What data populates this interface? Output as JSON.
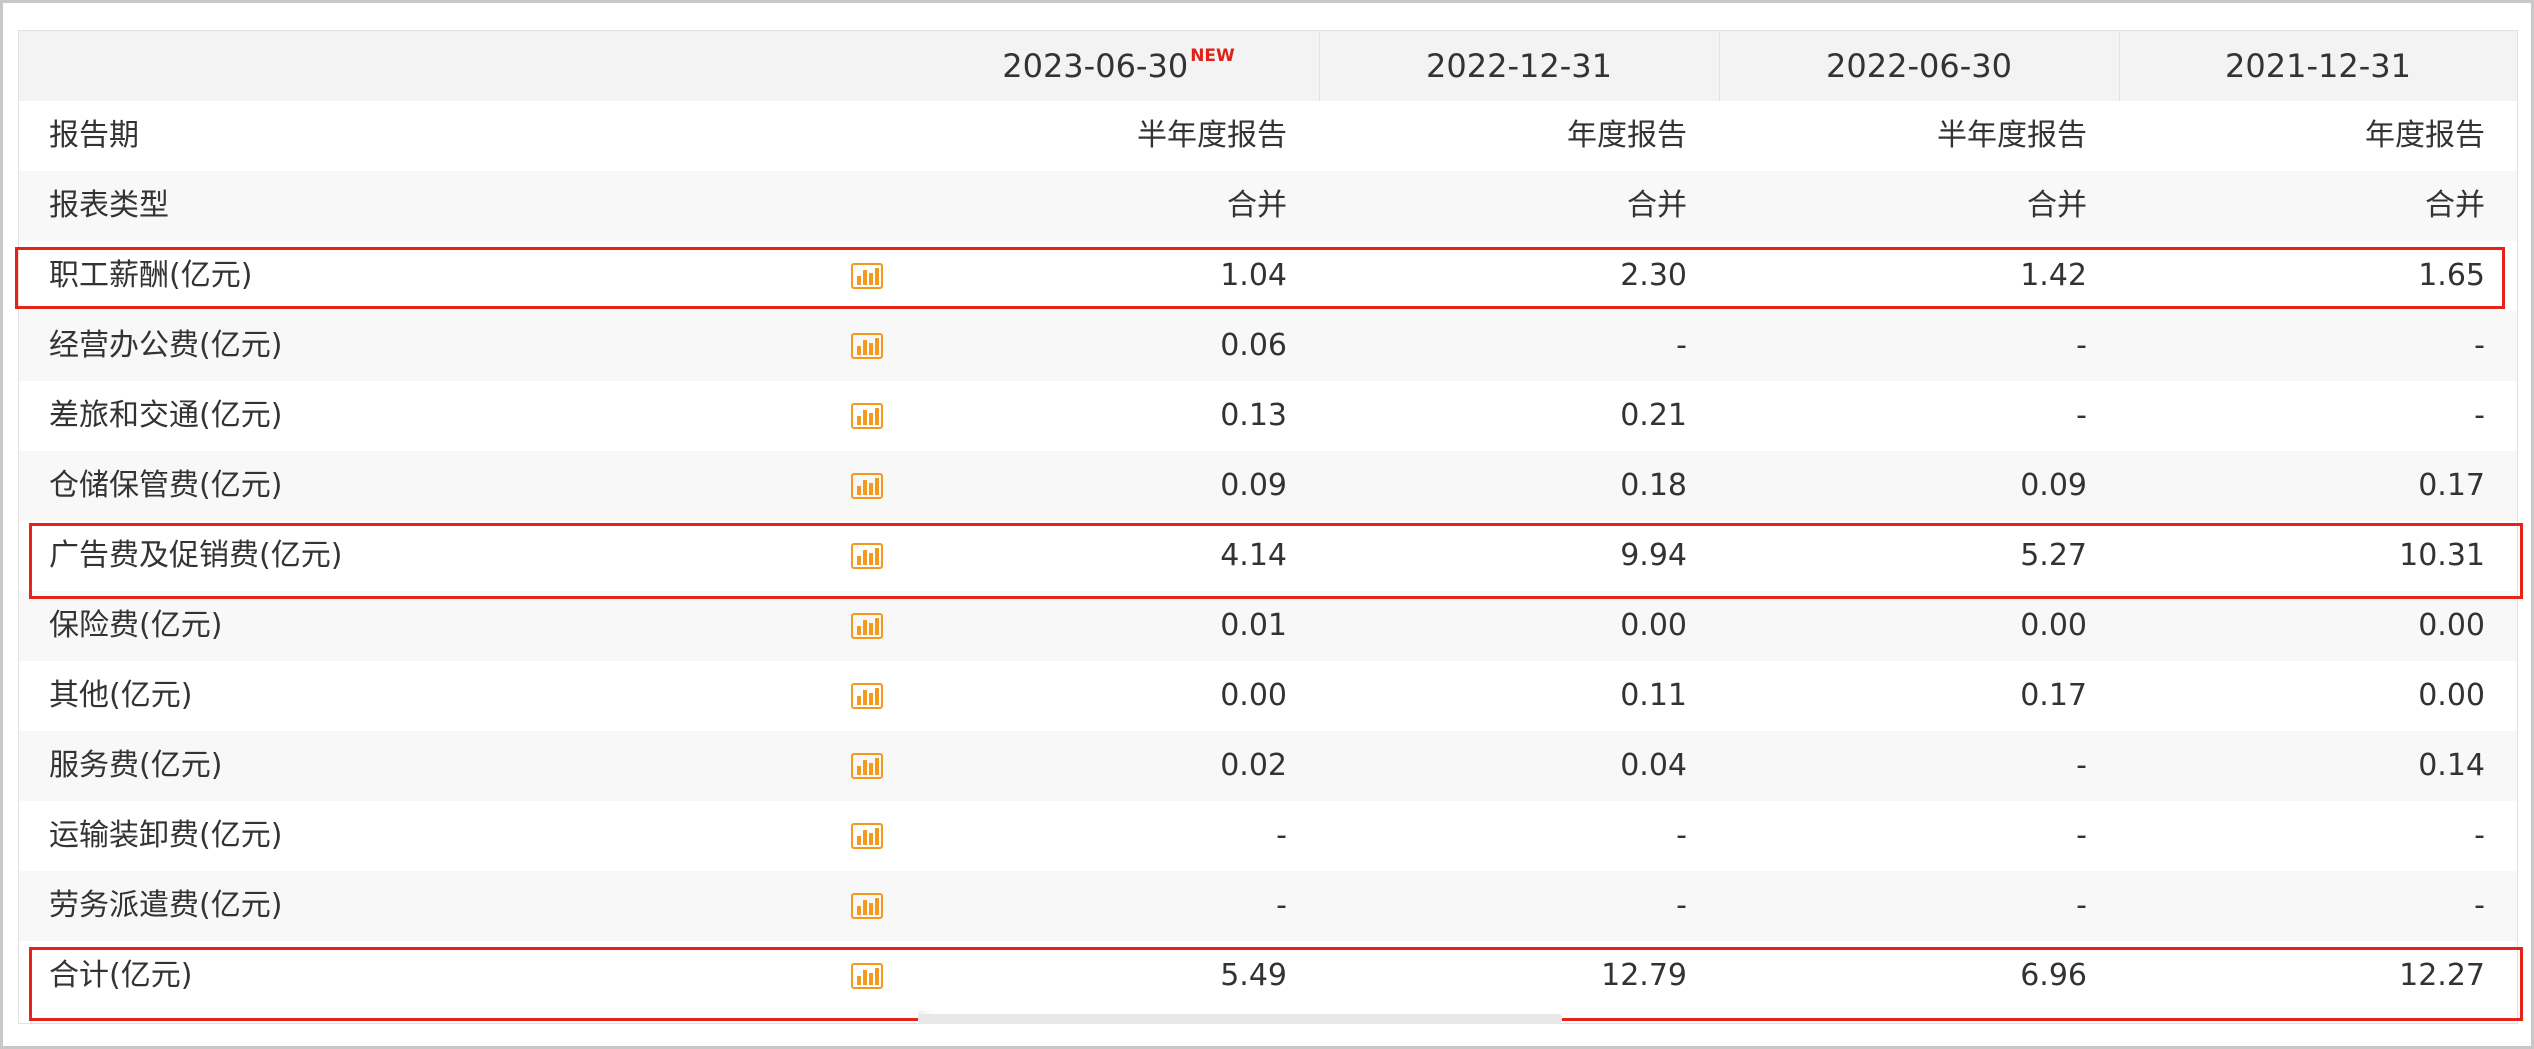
{
  "header": {
    "columns": [
      {
        "date": "2023-06-30",
        "badge": "NEW"
      },
      {
        "date": "2022-12-31",
        "badge": ""
      },
      {
        "date": "2022-06-30",
        "badge": ""
      },
      {
        "date": "2021-12-31",
        "badge": ""
      }
    ]
  },
  "rows": [
    {
      "label": "报告期",
      "values": [
        "半年度报告",
        "年度报告",
        "半年度报告",
        "年度报告"
      ],
      "chart_icon": false
    },
    {
      "label": "报表类型",
      "values": [
        "合并",
        "合并",
        "合并",
        "合并"
      ],
      "chart_icon": false
    },
    {
      "label": "职工薪酬(亿元)",
      "values": [
        "1.04",
        "2.30",
        "1.42",
        "1.65"
      ],
      "chart_icon": true,
      "highlighted": true
    },
    {
      "label": "经营办公费(亿元)",
      "values": [
        "0.06",
        "-",
        "-",
        "-"
      ],
      "chart_icon": true
    },
    {
      "label": "差旅和交通(亿元)",
      "values": [
        "0.13",
        "0.21",
        "-",
        "-"
      ],
      "chart_icon": true
    },
    {
      "label": "仓储保管费(亿元)",
      "values": [
        "0.09",
        "0.18",
        "0.09",
        "0.17"
      ],
      "chart_icon": true
    },
    {
      "label": "广告费及促销费(亿元)",
      "values": [
        "4.14",
        "9.94",
        "5.27",
        "10.31"
      ],
      "chart_icon": true,
      "highlighted": true
    },
    {
      "label": "保险费(亿元)",
      "values": [
        "0.01",
        "0.00",
        "0.00",
        "0.00"
      ],
      "chart_icon": true
    },
    {
      "label": "其他(亿元)",
      "values": [
        "0.00",
        "0.11",
        "0.17",
        "0.00"
      ],
      "chart_icon": true
    },
    {
      "label": "服务费(亿元)",
      "values": [
        "0.02",
        "0.04",
        "-",
        "0.14"
      ],
      "chart_icon": true
    },
    {
      "label": "运输装卸费(亿元)",
      "values": [
        "-",
        "-",
        "-",
        "-"
      ],
      "chart_icon": true
    },
    {
      "label": "劳务派遣费(亿元)",
      "values": [
        "-",
        "-",
        "-",
        "-"
      ],
      "chart_icon": true
    },
    {
      "label": "合计(亿元)",
      "values": [
        "5.49",
        "12.79",
        "6.96",
        "12.27"
      ],
      "chart_icon": true,
      "highlighted": true
    }
  ],
  "icons": {
    "chart": "bar-chart-icon"
  },
  "colors": {
    "highlight_border": "#e5231b",
    "new_badge": "#e0201a",
    "chart_icon": "#f39a1e",
    "header_bg": "#f3f3f3",
    "alt_row_bg": "#f8f8f8"
  }
}
